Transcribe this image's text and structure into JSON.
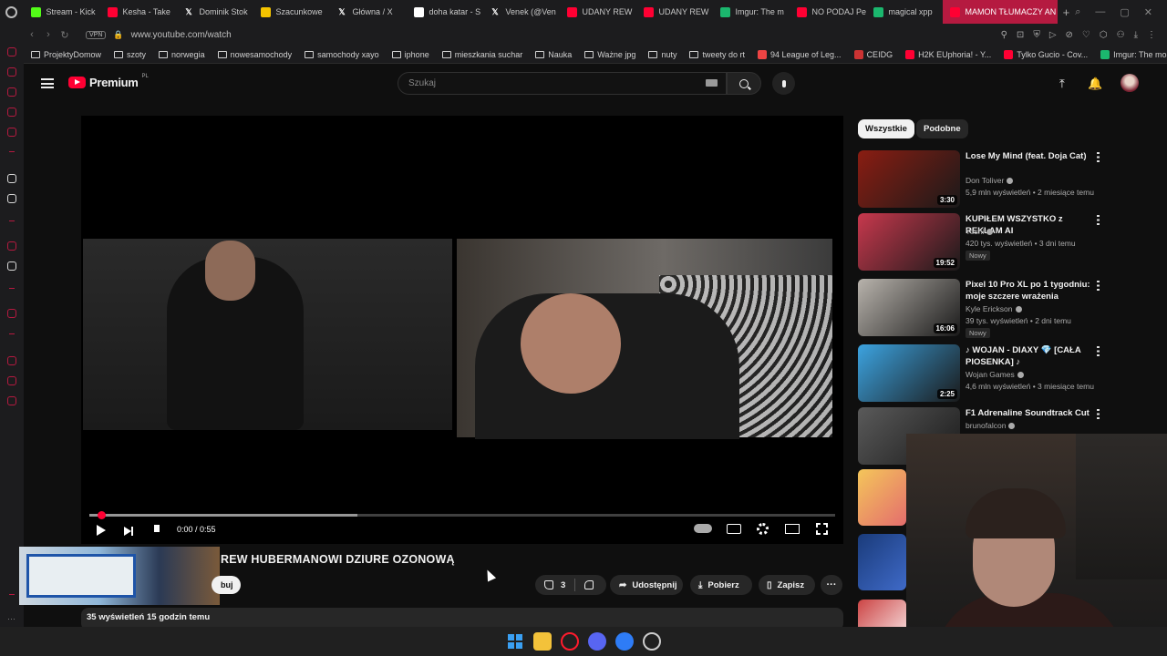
{
  "browser": {
    "tabs": [
      {
        "label": "Stream - Kick",
        "icon": "kick-icon",
        "color": "#53fc18"
      },
      {
        "label": "Kesha - Take",
        "icon": "youtube-icon",
        "color": "#ff0033"
      },
      {
        "label": "Dominik Stok",
        "icon": "x-icon",
        "color": "#ffffff"
      },
      {
        "label": "Szacunkowe",
        "icon": "site-icon",
        "color": "#f5c400"
      },
      {
        "label": "Główna / X",
        "icon": "x-icon",
        "color": "#ffffff"
      },
      {
        "label": "doha katar - S",
        "icon": "google-icon",
        "color": "#ffffff"
      },
      {
        "label": "Venek (@Ven",
        "icon": "x-icon",
        "color": "#ffffff"
      },
      {
        "label": "UDANY REW",
        "icon": "youtube-icon",
        "color": "#ff0033"
      },
      {
        "label": "UDANY REW",
        "icon": "youtube-icon",
        "color": "#ff0033"
      },
      {
        "label": "Imgur: The m",
        "icon": "imgur-icon",
        "color": "#1bb76e"
      },
      {
        "label": "NO PODAJ Pe",
        "icon": "youtube-icon",
        "color": "#ff0033"
      },
      {
        "label": "magical xpp",
        "icon": "imgur-icon",
        "color": "#1bb76e"
      },
      {
        "label": "MAMON TŁUMACZY AN",
        "icon": "youtube-icon",
        "color": "#ff0033",
        "active": true
      }
    ],
    "url": "www.youtube.com/watch",
    "vpn_label": "VPN",
    "bookmarks": [
      {
        "label": "ProjektyDomow",
        "type": "folder"
      },
      {
        "label": "szoty",
        "type": "folder"
      },
      {
        "label": "norwegia",
        "type": "folder"
      },
      {
        "label": "nowesamochody",
        "type": "folder"
      },
      {
        "label": "samochody xayo",
        "type": "folder"
      },
      {
        "label": "iphone",
        "type": "folder"
      },
      {
        "label": "mieszkania suchar",
        "type": "folder"
      },
      {
        "label": "Nauka",
        "type": "folder"
      },
      {
        "label": "Ważne jpg",
        "type": "folder"
      },
      {
        "label": "nuty",
        "type": "folder"
      },
      {
        "label": "tweety do rt",
        "type": "folder"
      },
      {
        "label": "94 League of Leg...",
        "type": "site",
        "color": "#e44"
      },
      {
        "label": "CEIDG",
        "type": "site",
        "color": "#c33"
      },
      {
        "label": "H2K EUphoria! - Y...",
        "type": "site",
        "color": "#ff0033"
      },
      {
        "label": "Tylko Gucio - Cov...",
        "type": "site",
        "color": "#ff0033"
      },
      {
        "label": "Imgur: The most a...",
        "type": "site",
        "color": "#1bb76e"
      }
    ]
  },
  "youtube": {
    "logo_text": "Premium",
    "logo_region": "PL",
    "search_placeholder": "Szukaj",
    "player": {
      "time": "0:00 / 0:55",
      "progress_played": 0.0,
      "progress_buffered": 0.36
    },
    "video_title": "REW HUBERMANOWI DZIURE OZONOWĄ",
    "subscribe_partial": "buj",
    "actions": {
      "likes": "3",
      "share": "Udostępnij",
      "download": "Pobierz",
      "save": "Zapisz"
    },
    "description_meta": "35 wyświetleń  15 godzin temu",
    "chips": [
      "Wszystkie",
      "Podobne"
    ],
    "recommendations": [
      {
        "title": "Lose My Mind (feat. Doja Cat)",
        "channel": "Don Toliver",
        "meta": "5,9 mln wyświetleń • 2 miesiące temu",
        "duration": "3:30",
        "new": "",
        "thumb": "#8a1d12"
      },
      {
        "title": "KUPIŁEM WSZYSTKO z REKLAM AI",
        "channel": "Yoshi",
        "meta": "420 tys. wyświetleń • 3 dni temu",
        "duration": "19:52",
        "new": "Nowy",
        "thumb": "#c8384d"
      },
      {
        "title": "Pixel 10 Pro XL po 1 tygodniu: moje szczere wrażenia",
        "channel": "Kyle Erickson",
        "meta": "39 tys. wyświetleń • 2 dni temu",
        "duration": "16:06",
        "new": "Nowy",
        "thumb": "#b8b3ac"
      },
      {
        "title": "♪ WOJAN - DIAXY 💎 [CAŁA PIOSENKA] ♪",
        "channel": "Wojan Games",
        "meta": "4,6 mln wyświetleń • 3 miesiące temu",
        "duration": "2:25",
        "new": "",
        "thumb": "#3ca3e0"
      },
      {
        "title": "F1 Adrenaline Soundtrack Cut",
        "channel": "brunofalcon",
        "meta": "",
        "duration": "",
        "new": "",
        "thumb": "#5a5a5a"
      }
    ]
  }
}
